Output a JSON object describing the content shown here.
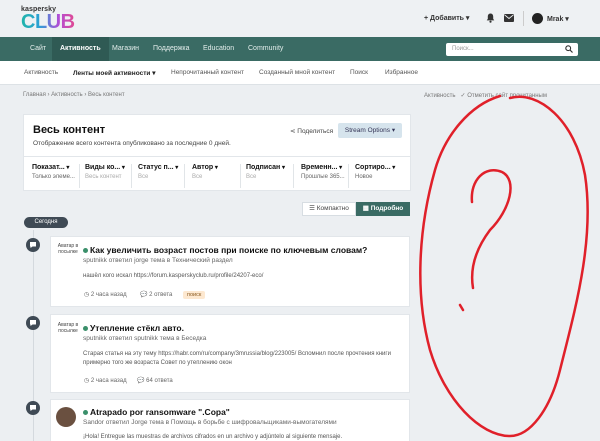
{
  "header": {
    "logo_small": "kaspersky",
    "logo_main": "CLUB",
    "add_label": "+ Добавить ▾",
    "user_name": "Mrak ▾"
  },
  "nav": {
    "items": [
      "Сайт",
      "Активность",
      "Магазин",
      "Поддержка",
      "Education",
      "Community"
    ],
    "active": "Активность",
    "search_placeholder": "Поиск..."
  },
  "subnav": {
    "items": [
      "Активность",
      "Ленты моей активности ▾",
      "Непрочитанный контент",
      "Созданный мной контент",
      "Поиск",
      "Избранное"
    ]
  },
  "breadcrumb": "Главная › Активность › Весь контент",
  "breadcrumb_right": {
    "activity": "Активность",
    "mark_read": "Отметить сайт прочитанным"
  },
  "content_header": {
    "title": "Весь контент",
    "subtitle": "Отображение всего контента опубликовано за последние 0 дней.",
    "share": "Поделиться",
    "stream_options": "Stream Options ▾"
  },
  "filters": [
    {
      "label": "Показат...",
      "value": "Только элеме...",
      "muted": false
    },
    {
      "label": "Виды ко...",
      "value": "Весь контент",
      "muted": true
    },
    {
      "label": "Статус п...",
      "value": "Все",
      "muted": true
    },
    {
      "label": "Автор",
      "value": "Все",
      "muted": true
    },
    {
      "label": "Подписан",
      "value": "Все",
      "muted": true
    },
    {
      "label": "Временн...",
      "value": "Прошлые 365...",
      "muted": false
    },
    {
      "label": "Сортиро...",
      "value": "Новое",
      "muted": false
    }
  ],
  "view_toggle": {
    "compact": "Компактно",
    "detailed": "Подробно"
  },
  "timeline_label": "Сегодня",
  "posts": [
    {
      "avatar_text": "Аватар в посылке",
      "title": "Как увеличить возраст постов при поиске по ключевым словам?",
      "meta": "sputnikk ответил jorge тема в Технический раздел",
      "body": "нашёл кого искал https://forum.kasperskyclub.ru/profile/24207-eco/",
      "time": "2 часа назад",
      "replies": "2 ответа",
      "tag": "поиск"
    },
    {
      "avatar_text": "Аватар в посылке",
      "title": "Утепление стёкл авто.",
      "meta": "sputnikk ответил sputnikk тема в Беседка",
      "body": "Старая статья на эту тему https://habr.com/ru/company/3mrussia/blog/223005/ Вспомнил после прочтения книги примерно того же возраста Совет по утеплению окон",
      "time": "2 часа назад",
      "replies": "64 ответа",
      "tag": ""
    },
    {
      "avatar_text": "",
      "title": "Atrapado por ransomware \".Copa\"",
      "meta": "Sandor ответил Jorge тема в Помощь в борьбе с шифровальщиками-вымогателями",
      "body": "¡Hola! Entregue las muestras de archivos cifrados en un archivo y adjúntelo al siguiente mensaje.",
      "time": "",
      "replies": "",
      "tag": ""
    }
  ],
  "colors": {
    "nav_bg": "#3a6b64",
    "accent": "#3a6b64",
    "drawing_stroke": "#e0202a"
  }
}
